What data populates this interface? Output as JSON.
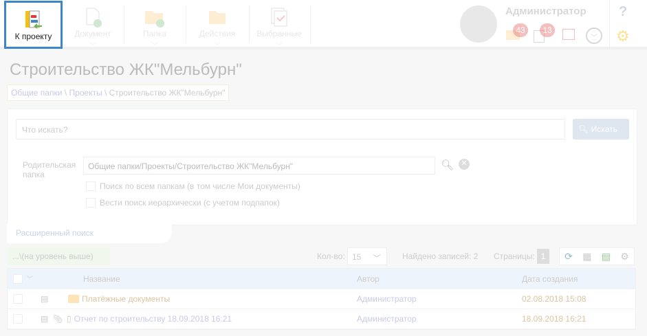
{
  "toolbar": {
    "back": "К проекту",
    "document": "Документ",
    "folder": "Папка",
    "actions": "Действия",
    "favorites": "Выбранные"
  },
  "user": {
    "name": "Администратор",
    "mail_count": "43",
    "tasks_count": "13",
    "help": "?"
  },
  "page": {
    "title": "Строительство ЖК\"Мельбурн\"",
    "breadcrumb": [
      "Общие папки",
      "Проекты",
      "Строительство ЖК\"Мельбурн\""
    ],
    "sep": " \\ "
  },
  "search": {
    "placeholder": "Что искать?",
    "button": "Искать",
    "parent_label": "Родительская папка",
    "parent_value": "Общие папки/Проекты/Строительство ЖК\"Мельбурн\"",
    "opt_all": "Поиск по всем папкам (в том числе Мои документы)",
    "opt_hier": "Вести поиск иерархически (с учетом подпапок)",
    "advanced": "Расширенный поиск"
  },
  "list": {
    "up": "...\\(на уровень выше)",
    "count_label": "Кол-во:",
    "count_value": "15",
    "found": "Найдено записей: 2",
    "pages_label": "Страницы:",
    "page": "1",
    "columns": [
      "Название",
      "Автор",
      "Дата создания"
    ],
    "rows": [
      {
        "name": "Платёжные документы",
        "author": "Администратор",
        "date": "02.08.2018 15:08"
      },
      {
        "name": "Отчет по строительству 18.09.2018 16:21",
        "author": "Администратор",
        "date": "18.09.2018 16:21"
      }
    ]
  }
}
